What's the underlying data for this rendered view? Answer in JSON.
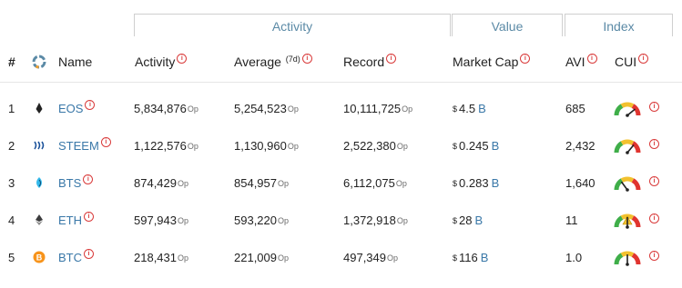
{
  "group_headers": {
    "activity": "Activity",
    "value": "Value",
    "index": "Index"
  },
  "columns": {
    "rank": "#",
    "name": "Name",
    "activity": "Activity",
    "average": "Average",
    "average_suffix": "(7d)",
    "record": "Record",
    "market_cap": "Market Cap",
    "avi": "AVI",
    "cui": "CUI"
  },
  "info_glyph": "i",
  "op_unit": "Op",
  "currency_symbol": "$",
  "rows": [
    {
      "rank": "1",
      "name": "EOS",
      "icon": "eos-logo-icon",
      "activity": "5,834,876",
      "average": "5,254,523",
      "record": "10,111,725",
      "market_cap": "4.5",
      "cap_unit": "B",
      "avi": "685",
      "cui_level": 0.78
    },
    {
      "rank": "2",
      "name": "STEEM",
      "icon": "steem-logo-icon",
      "activity": "1,122,576",
      "average": "1,130,960",
      "record": "2,522,380",
      "market_cap": "0.245",
      "cap_unit": "B",
      "avi": "2,432",
      "cui_level": 0.72
    },
    {
      "rank": "3",
      "name": "BTS",
      "icon": "bts-logo-icon",
      "activity": "874,429",
      "average": "854,957",
      "record": "6,112,075",
      "market_cap": "0.283",
      "cap_unit": "B",
      "avi": "1,640",
      "cui_level": 0.3
    },
    {
      "rank": "4",
      "name": "ETH",
      "icon": "eth-logo-icon",
      "activity": "597,943",
      "average": "593,220",
      "record": "1,372,918",
      "market_cap": "28",
      "cap_unit": "B",
      "avi": "11",
      "cui_level": 0.5
    },
    {
      "rank": "5",
      "name": "BTC",
      "icon": "btc-logo-icon",
      "activity": "218,431",
      "average": "221,009",
      "record": "497,349",
      "market_cap": "116",
      "cap_unit": "B",
      "avi": "1.0",
      "cui_level": 0.5
    }
  ],
  "colors": {
    "link": "#3a78a8",
    "info": "#d93b3b",
    "gauge_green": "#3fae49",
    "gauge_yellow": "#f2c12e",
    "gauge_red": "#e0342f",
    "eth_gauge_alert": "#f2c12e"
  }
}
